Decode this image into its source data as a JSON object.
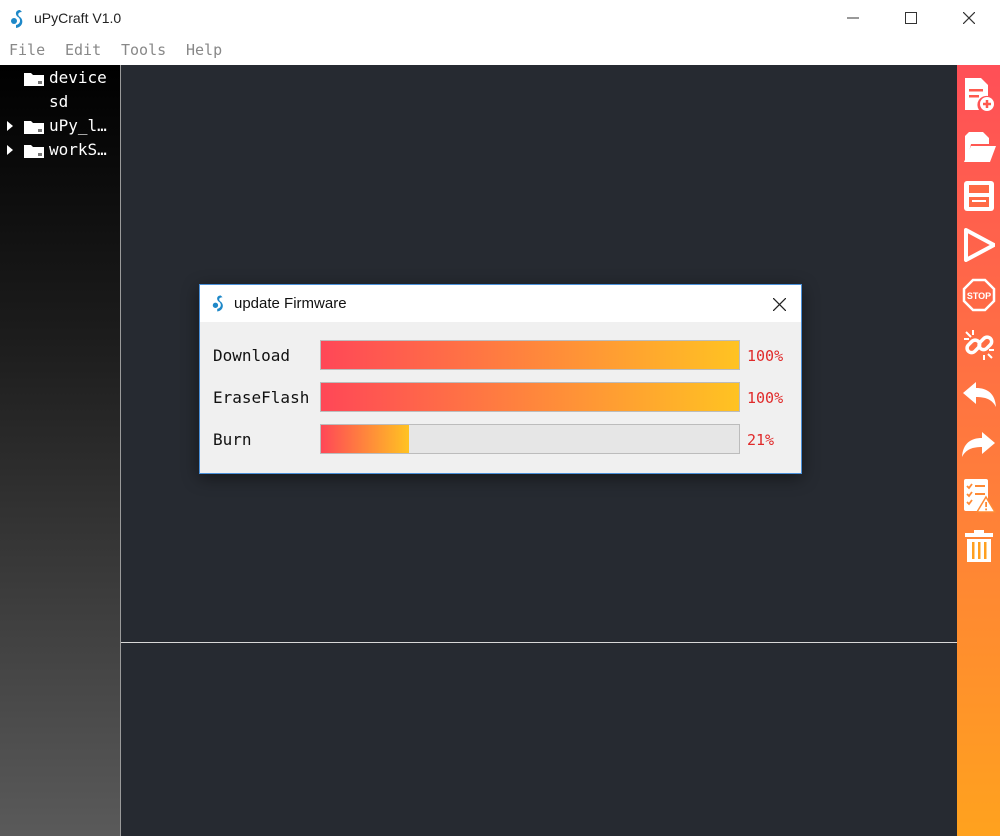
{
  "window": {
    "title": "uPyCraft V1.0"
  },
  "menu": [
    {
      "label": "File"
    },
    {
      "label": "Edit"
    },
    {
      "label": "Tools"
    },
    {
      "label": "Help"
    }
  ],
  "tree": [
    {
      "label": "device",
      "expandable": false
    },
    {
      "label": "sd",
      "expandable": false
    },
    {
      "label": "uPy_l…",
      "expandable": true
    },
    {
      "label": "workS…",
      "expandable": true
    }
  ],
  "toolbar": [
    {
      "icon": "new-file-icon"
    },
    {
      "icon": "open-file-icon"
    },
    {
      "icon": "save-icon"
    },
    {
      "icon": "run-icon"
    },
    {
      "icon": "stop-icon"
    },
    {
      "icon": "connect-icon"
    },
    {
      "icon": "undo-icon"
    },
    {
      "icon": "redo-icon"
    },
    {
      "icon": "syntax-check-icon"
    },
    {
      "icon": "clear-icon"
    }
  ],
  "dialog": {
    "title": "update Firmware",
    "rows": [
      {
        "label": "Download",
        "progress": 100,
        "percent_text": "100%"
      },
      {
        "label": "EraseFlash",
        "progress": 100,
        "percent_text": "100%"
      },
      {
        "label": "Burn",
        "progress": 21,
        "percent_text": "21%"
      }
    ]
  },
  "colors": {
    "accent": "#ff4f57",
    "accent_end": "#ffa21e",
    "editor_bg": "#262a31",
    "percent_text": "#e02a2a"
  }
}
